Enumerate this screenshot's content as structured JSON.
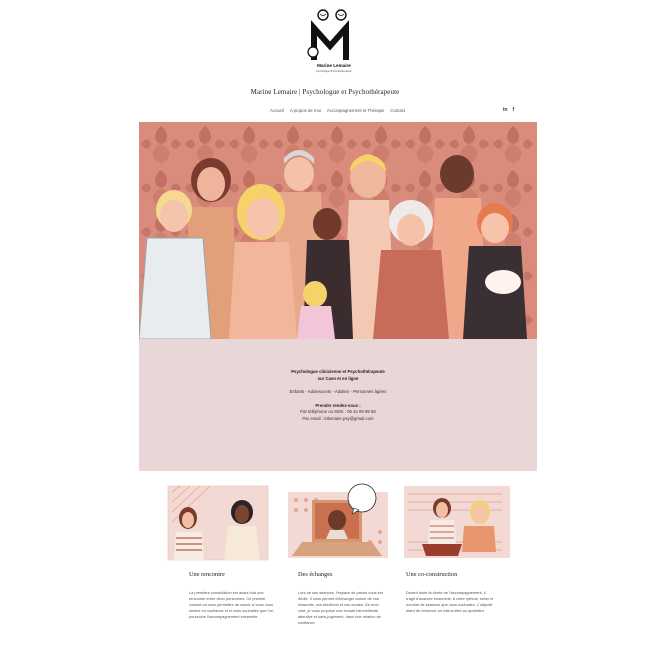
{
  "logo": {
    "name_text": "Marine Lemaire",
    "tagline_text": "Psychologue & Psychothérapeute"
  },
  "site_title": "Marine Lemaire | Psychologue et Psychothérapeute",
  "nav": [
    "Accueil",
    "A propos de moi",
    "Accompagnement et Thérapie",
    "Contact"
  ],
  "social": {
    "linkedin": "in",
    "facebook": "f"
  },
  "colors": {
    "accent": "#e8d7d6",
    "hero_bg": "#d88c7c",
    "card_bg": "#f2d9d3"
  },
  "hero": {
    "alt": ""
  },
  "panel": {
    "line1": "Psychologue clinicienne et Psychothérapeute",
    "line2": "sur Caen et en ligne",
    "audience": "Enfants - Adolescents - Adultes - Personnes âgées",
    "appt_title": "Prendre rendez-vous :",
    "phone": "Par téléphone ou SMS : 06 44 09 88 50",
    "email": "Par email : mlemaire.psy@gmail.com"
  },
  "cards": [
    {
      "title": "Une rencontre",
      "text": "La première consultation est avant tout une rencontre entre deux personnes. Ce premier contact va vous permettre de savoir si vous vous sentez en confiance et si vous souhaitez que l'on poursuive l'accompagnement ensemble."
    },
    {
      "title": "Des échanges",
      "text": "Lors de ces séances, l'espace de parole vous est dédié. Il vous permet d'échanger autour de vos ressentis, vos émotions et vos doutes. De mon côté, je vous propose une écoute bienveillante, attentive et sans jugement, dans une relation de confiance."
    },
    {
      "title": "Une co-construction",
      "text": "Durant toute la durée de l'accompagnement, il s'agit d'avancer ensemble, à votre rythme, selon le nombre de séances que vous souhaitez. L'objectif étant de retrouver un mieux-être au quotidien."
    }
  ]
}
